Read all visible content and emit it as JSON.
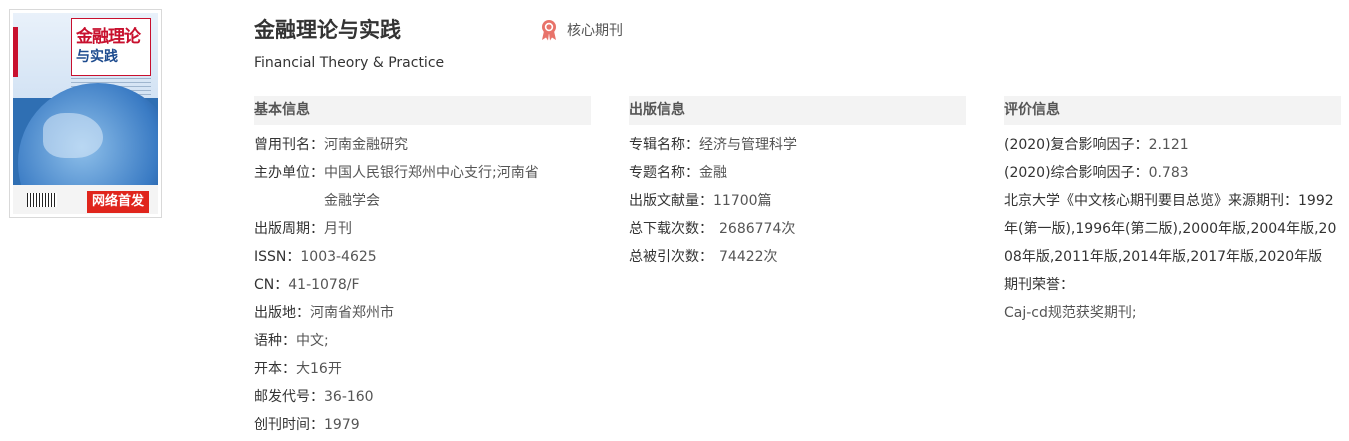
{
  "cover": {
    "title_line1": "金融理论",
    "title_line2": "与实践",
    "badge": "网络首发"
  },
  "journal": {
    "title": "金融理论与实践",
    "core_label": "核心期刊",
    "en_title": "Financial Theory & Practice"
  },
  "basic": {
    "heading": "基本信息",
    "rows": [
      {
        "k": "曾用刊名：",
        "v": "河南金融研究"
      },
      {
        "k": "主办单位：",
        "v": "中国人民银行郑州中心支行;河南省金融学会"
      },
      {
        "k": "出版周期：",
        "v": "月刊"
      },
      {
        "k": "ISSN：",
        "v": "1003-4625"
      },
      {
        "k": "CN：",
        "v": "41-1078/F"
      },
      {
        "k": "出版地：",
        "v": "河南省郑州市"
      },
      {
        "k": "语种：",
        "v": "中文;"
      },
      {
        "k": "开本：",
        "v": "大16开"
      },
      {
        "k": "邮发代号：",
        "v": "36-160"
      },
      {
        "k": "创刊时间：",
        "v": "1979"
      }
    ]
  },
  "publish": {
    "heading": "出版信息",
    "rows": [
      {
        "k": "专辑名称：",
        "v": "经济与管理科学"
      },
      {
        "k": "专题名称：",
        "v": "金融"
      },
      {
        "k": "出版文献量：",
        "v": "11700篇"
      },
      {
        "k": "总下载次数：",
        "v": "2686774次"
      },
      {
        "k": "总被引次数：",
        "v": "74422次"
      }
    ]
  },
  "evaluation": {
    "heading": "评价信息",
    "impact1_k": "(2020)复合影响因子：",
    "impact1_v": "2.121",
    "impact2_k": "(2020)综合影响因子：",
    "impact2_v": "0.783",
    "pku_text": "北京大学《中文核心期刊要目总览》来源期刊：1992年(第一版),1996年(第二版),2000年版,2004年版,2008年版,2011年版,2014年版,2017年版,2020年版",
    "honor_k": "期刊荣誉：",
    "honor_v": "Caj-cd规范获奖期刊;"
  },
  "colors": {
    "badge_red": "#e0251c",
    "core_icon": "#e8736a",
    "section_bg": "#f3f3f3"
  }
}
